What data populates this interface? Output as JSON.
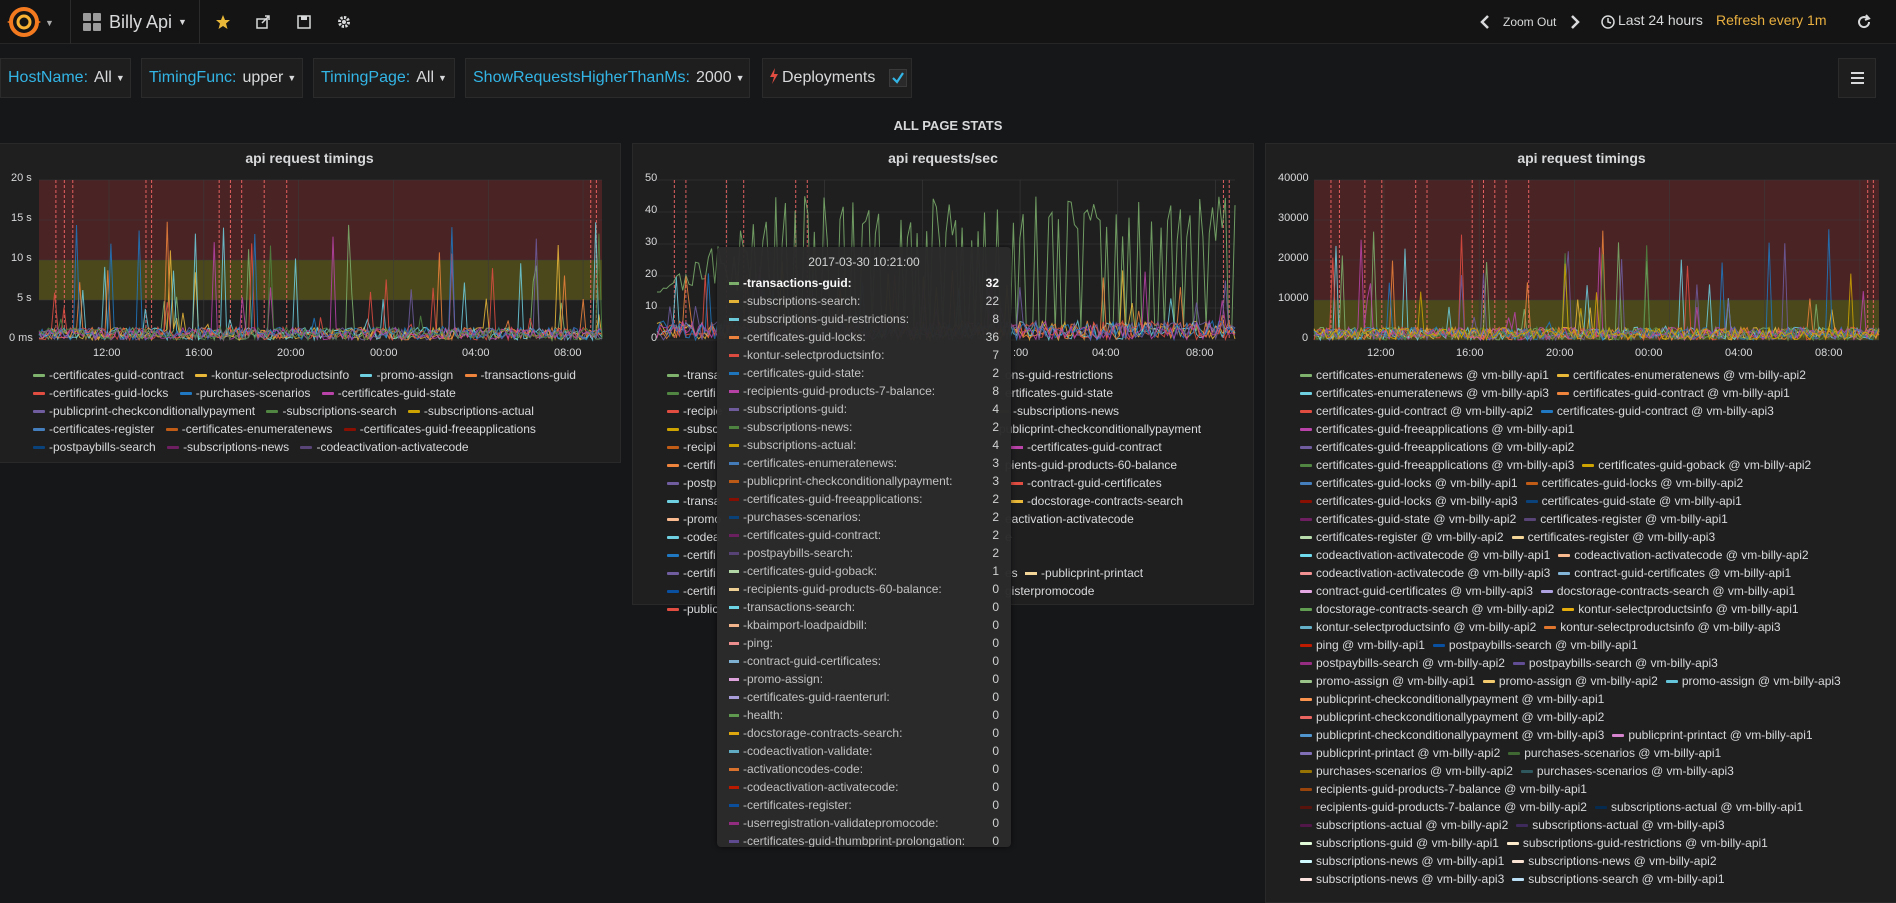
{
  "navbar": {
    "dashboard_title": "Billy Api",
    "zoom_out": "Zoom Out",
    "time_range": "Last 24 hours",
    "refresh": "Refresh every 1m"
  },
  "variables": [
    {
      "label": "HostName:",
      "value": "All"
    },
    {
      "label": "TimingFunc:",
      "value": "upper"
    },
    {
      "label": "TimingPage:",
      "value": "All"
    },
    {
      "label": "ShowRequestsHigherThanMs:",
      "value": "2000"
    }
  ],
  "annotations_toggle": {
    "label": "Deployments",
    "checked": true
  },
  "row_title": "ALL PAGE STATS",
  "colors": {
    "accent": "#33b5e5",
    "refresh": "#e9b040",
    "threshold_critical": "#6b2a2a",
    "threshold_warning": "#6b6418",
    "annotation": "#ff5f5f"
  },
  "panels": [
    {
      "title": "api request timings",
      "y_ticks": [
        "20 s",
        "15 s",
        "10 s",
        "5 s",
        "0 ms"
      ],
      "x_ticks": [
        "12:00",
        "16:00",
        "20:00",
        "00:00",
        "04:00",
        "08:00"
      ],
      "legend": [
        {
          "name": "-certificates-guid-contract",
          "color": "#7eb26d"
        },
        {
          "name": "-kontur-selectproductsinfo",
          "color": "#eab839"
        },
        {
          "name": "-promo-assign",
          "color": "#6ed0e0"
        },
        {
          "name": "-transactions-guid",
          "color": "#ef843c"
        },
        {
          "name": "-certificates-guid-locks",
          "color": "#e24d42"
        },
        {
          "name": "-purchases-scenarios",
          "color": "#1f78c1"
        },
        {
          "name": "-certificates-guid-state",
          "color": "#ba43a9"
        },
        {
          "name": "-publicprint-checkconditionallypayment",
          "color": "#705da0"
        },
        {
          "name": "-subscriptions-search",
          "color": "#508642"
        },
        {
          "name": "-subscriptions-actual",
          "color": "#cca300"
        },
        {
          "name": "-certificates-register",
          "color": "#447ebc"
        },
        {
          "name": "-certificates-enumeratenews",
          "color": "#c15c17"
        },
        {
          "name": "-certificates-guid-freeapplications",
          "color": "#890f02"
        },
        {
          "name": "-postpaybills-search",
          "color": "#0a437c"
        },
        {
          "name": "-subscriptions-news",
          "color": "#6d1f62"
        },
        {
          "name": "-codeactivation-activatecode",
          "color": "#584477"
        }
      ]
    },
    {
      "title": "api requests/sec",
      "y_ticks": [
        "50",
        "40",
        "30",
        "20",
        "10",
        "0"
      ],
      "x_ticks": [
        "04:00",
        "08:00"
      ],
      "x_tick_partial": ":00",
      "legend": [
        {
          "name": "-transa",
          "right": "ons-guid-restrictions",
          "color": "#7eb26d",
          "rcolor": "#6ed0e0"
        },
        {
          "name": "-certifi",
          "right": "ertificates-guid-state",
          "color": "#508642",
          "rcolor": "#ba43a9"
        },
        {
          "name": "-recipie",
          "right": "-subscriptions-news",
          "color": "#e24d42",
          "rcolor": "#508642"
        },
        {
          "name": "-subsc",
          "right": "publicprint-checkconditionallypayment",
          "color": "#cca300",
          "rcolor": "#705da0"
        },
        {
          "name": "-recipi",
          "right": "-certificates-guid-contract",
          "color": "#c15c17",
          "rcolor": "#ba43a9"
        },
        {
          "name": "-certifi",
          "right": "pients-guid-products-60-balance",
          "color": "#ef843c",
          "rcolor": "#eab839"
        },
        {
          "name": "-postp",
          "right": "-contract-guid-certificates",
          "color": "#705da0",
          "rcolor": "#e24d42"
        },
        {
          "name": "-transa",
          "right": "-docstorage-contracts-search",
          "color": "#6ed0e0",
          "rcolor": "#eab839"
        },
        {
          "name": "-promo",
          "right": "eactivation-activatecode",
          "color": "#f9ba8f",
          "rcolor": "#584477"
        },
        {
          "name": "-codea",
          "right": "e",
          "color": "#6ed0e0",
          "rcolor": "#1f78c1"
        },
        {
          "name": "-certifi",
          "right": "",
          "color": "#1f78c1",
          "rcolor": "#1f78c1"
        },
        {
          "name": "-certifi",
          "right": "es",
          "rright": "-publicprint-printact",
          "color": "#705da0",
          "rcolor": "#f4d598"
        },
        {
          "name": "-certifi",
          "right": "gisterpromocode",
          "color": "#0a50a1",
          "rcolor": "#0a50a1"
        },
        {
          "name": "-public",
          "right": "",
          "color": "#e24d42",
          "rcolor": "#e24d42"
        }
      ]
    },
    {
      "title": "api request timings",
      "y_ticks": [
        "40000",
        "30000",
        "20000",
        "10000",
        "0"
      ],
      "x_ticks": [
        "12:00",
        "16:00",
        "20:00",
        "00:00",
        "04:00",
        "08:00"
      ],
      "legend_rows": [
        [
          {
            "name": "certificates-enumeratenews @ vm-billy-api1",
            "color": "#7eb26d"
          },
          {
            "name": "certificates-enumeratenews @ vm-billy-api2",
            "color": "#eab839"
          }
        ],
        [
          {
            "name": "certificates-enumeratenews @ vm-billy-api3",
            "color": "#6ed0e0"
          },
          {
            "name": "certificates-guid-contract @ vm-billy-api1",
            "color": "#ef843c"
          }
        ],
        [
          {
            "name": "certificates-guid-contract @ vm-billy-api2",
            "color": "#e24d42"
          },
          {
            "name": "certificates-guid-contract @ vm-billy-api3",
            "color": "#1f78c1"
          }
        ],
        [
          {
            "name": "certificates-guid-freeapplications @ vm-billy-api1",
            "color": "#ba43a9"
          }
        ],
        [
          {
            "name": "certificates-guid-freeapplications @ vm-billy-api2",
            "color": "#705da0"
          }
        ],
        [
          {
            "name": "certificates-guid-freeapplications @ vm-billy-api3",
            "color": "#508642"
          },
          {
            "name": "certificates-guid-goback @ vm-billy-api2",
            "color": "#cca300"
          }
        ],
        [
          {
            "name": "certificates-guid-locks @ vm-billy-api1",
            "color": "#447ebc"
          },
          {
            "name": "certificates-guid-locks @ vm-billy-api2",
            "color": "#c15c17"
          }
        ],
        [
          {
            "name": "certificates-guid-locks @ vm-billy-api3",
            "color": "#890f02"
          },
          {
            "name": "certificates-guid-state @ vm-billy-api1",
            "color": "#0a437c"
          }
        ],
        [
          {
            "name": "certificates-guid-state @ vm-billy-api2",
            "color": "#6d1f62"
          },
          {
            "name": "certificates-register @ vm-billy-api1",
            "color": "#584477"
          }
        ],
        [
          {
            "name": "certificates-register @ vm-billy-api2",
            "color": "#b7dbab"
          },
          {
            "name": "certificates-register @ vm-billy-api3",
            "color": "#f4d598"
          }
        ],
        [
          {
            "name": "codeactivation-activatecode @ vm-billy-api1",
            "color": "#70dbed"
          },
          {
            "name": "codeactivation-activatecode @ vm-billy-api2",
            "color": "#f9ba8f"
          }
        ],
        [
          {
            "name": "codeactivation-activatecode @ vm-billy-api3",
            "color": "#f29191"
          },
          {
            "name": "contract-guid-certificates @ vm-billy-api1",
            "color": "#82b5d8"
          }
        ],
        [
          {
            "name": "contract-guid-certificates @ vm-billy-api3",
            "color": "#e5a8e2"
          },
          {
            "name": "docstorage-contracts-search @ vm-billy-api1",
            "color": "#aea2e0"
          }
        ],
        [
          {
            "name": "docstorage-contracts-search @ vm-billy-api2",
            "color": "#629e51"
          },
          {
            "name": "kontur-selectproductsinfo @ vm-billy-api1",
            "color": "#e5ac0e"
          }
        ],
        [
          {
            "name": "kontur-selectproductsinfo @ vm-billy-api2",
            "color": "#64b0c8"
          },
          {
            "name": "kontur-selectproductsinfo @ vm-billy-api3",
            "color": "#e0752d"
          }
        ],
        [
          {
            "name": "ping @ vm-billy-api1",
            "color": "#bf1b00"
          },
          {
            "name": "postpaybills-search @ vm-billy-api1",
            "color": "#0a50a1"
          }
        ],
        [
          {
            "name": "postpaybills-search @ vm-billy-api2",
            "color": "#962d82"
          },
          {
            "name": "postpaybills-search @ vm-billy-api3",
            "color": "#614d93"
          }
        ],
        [
          {
            "name": "promo-assign @ vm-billy-api1",
            "color": "#9ac48a"
          },
          {
            "name": "promo-assign @ vm-billy-api2",
            "color": "#f2c96d"
          },
          {
            "name": "promo-assign @ vm-billy-api3",
            "color": "#65c5db"
          }
        ],
        [
          {
            "name": "publicprint-checkconditionallypayment @ vm-billy-api1",
            "color": "#f9934e"
          }
        ],
        [
          {
            "name": "publicprint-checkconditionallypayment @ vm-billy-api2",
            "color": "#ea6460"
          }
        ],
        [
          {
            "name": "publicprint-checkconditionallypayment @ vm-billy-api3",
            "color": "#5195ce"
          },
          {
            "name": "publicprint-printact @ vm-billy-api1",
            "color": "#d683ce"
          }
        ],
        [
          {
            "name": "publicprint-printact @ vm-billy-api2",
            "color": "#806eb7"
          },
          {
            "name": "purchases-scenarios @ vm-billy-api1",
            "color": "#3f6833"
          }
        ],
        [
          {
            "name": "purchases-scenarios @ vm-billy-api2",
            "color": "#967302"
          },
          {
            "name": "purchases-scenarios @ vm-billy-api3",
            "color": "#2f575e"
          }
        ],
        [
          {
            "name": "recipients-guid-products-7-balance @ vm-billy-api1",
            "color": "#99440a"
          }
        ],
        [
          {
            "name": "recipients-guid-products-7-balance @ vm-billy-api2",
            "color": "#58140c"
          },
          {
            "name": "subscriptions-actual @ vm-billy-api1",
            "color": "#052b51"
          }
        ],
        [
          {
            "name": "subscriptions-actual @ vm-billy-api2",
            "color": "#511749"
          },
          {
            "name": "subscriptions-actual @ vm-billy-api3",
            "color": "#3f2b5b"
          }
        ],
        [
          {
            "name": "subscriptions-guid @ vm-billy-api1",
            "color": "#e0f9d7"
          },
          {
            "name": "subscriptions-guid-restrictions @ vm-billy-api1",
            "color": "#fceaca"
          }
        ],
        [
          {
            "name": "subscriptions-news @ vm-billy-api1",
            "color": "#cffaff"
          },
          {
            "name": "subscriptions-news @ vm-billy-api2",
            "color": "#f9e2d2"
          }
        ],
        [
          {
            "name": "subscriptions-news @ vm-billy-api3",
            "color": "#fce2de"
          },
          {
            "name": "subscriptions-search @ vm-billy-api1",
            "color": "#badff4"
          }
        ]
      ]
    }
  ],
  "tooltip": {
    "time": "2017-03-30 10:21:00",
    "rows": [
      {
        "name": "-transactions-guid:",
        "value": "32",
        "color": "#7eb26d",
        "highlight": true
      },
      {
        "name": "-subscriptions-search:",
        "value": "22",
        "color": "#eab839"
      },
      {
        "name": "-subscriptions-guid-restrictions:",
        "value": "8",
        "color": "#6ed0e0"
      },
      {
        "name": "-certificates-guid-locks:",
        "value": "36",
        "color": "#ef843c"
      },
      {
        "name": "-kontur-selectproductsinfo:",
        "value": "7",
        "color": "#e24d42"
      },
      {
        "name": "-certificates-guid-state:",
        "value": "2",
        "color": "#1f78c1"
      },
      {
        "name": "-recipients-guid-products-7-balance:",
        "value": "8",
        "color": "#ba43a9"
      },
      {
        "name": "-subscriptions-guid:",
        "value": "4",
        "color": "#705da0"
      },
      {
        "name": "-subscriptions-news:",
        "value": "2",
        "color": "#508642"
      },
      {
        "name": "-subscriptions-actual:",
        "value": "4",
        "color": "#cca300"
      },
      {
        "name": "-certificates-enumeratenews:",
        "value": "3",
        "color": "#447ebc"
      },
      {
        "name": "-publicprint-checkconditionallypayment:",
        "value": "3",
        "color": "#c15c17"
      },
      {
        "name": "-certificates-guid-freeapplications:",
        "value": "2",
        "color": "#890f02"
      },
      {
        "name": "-purchases-scenarios:",
        "value": "2",
        "color": "#0a437c"
      },
      {
        "name": "-certificates-guid-contract:",
        "value": "2",
        "color": "#6d1f62"
      },
      {
        "name": "-postpaybills-search:",
        "value": "2",
        "color": "#584477"
      },
      {
        "name": "-certificates-guid-goback:",
        "value": "1",
        "color": "#b7dbab"
      },
      {
        "name": "-recipients-guid-products-60-balance:",
        "value": "0",
        "color": "#f4d598"
      },
      {
        "name": "-transactions-search:",
        "value": "0",
        "color": "#70dbed"
      },
      {
        "name": "-kbaimport-loadpaidbill:",
        "value": "0",
        "color": "#f9ba8f"
      },
      {
        "name": "-ping:",
        "value": "0",
        "color": "#f29191"
      },
      {
        "name": "-contract-guid-certificates:",
        "value": "0",
        "color": "#82b5d8"
      },
      {
        "name": "-promo-assign:",
        "value": "0",
        "color": "#e5a8e2"
      },
      {
        "name": "-certificates-guid-raenterurl:",
        "value": "0",
        "color": "#aea2e0"
      },
      {
        "name": "-health:",
        "value": "0",
        "color": "#629e51"
      },
      {
        "name": "-docstorage-contracts-search:",
        "value": "0",
        "color": "#e5ac0e"
      },
      {
        "name": "-codeactivation-validate:",
        "value": "0",
        "color": "#64b0c8"
      },
      {
        "name": "-activationcodes-code:",
        "value": "0",
        "color": "#e0752d"
      },
      {
        "name": "-codeactivation-activatecode:",
        "value": "0",
        "color": "#bf1b00"
      },
      {
        "name": "-certificates-register:",
        "value": "0",
        "color": "#0a50a1"
      },
      {
        "name": "-userregistration-validatepromocode:",
        "value": "0",
        "color": "#962d82"
      },
      {
        "name": "-certificates-guid-thumbprint-prolongation:",
        "value": "0",
        "color": "#614d93"
      }
    ]
  }
}
